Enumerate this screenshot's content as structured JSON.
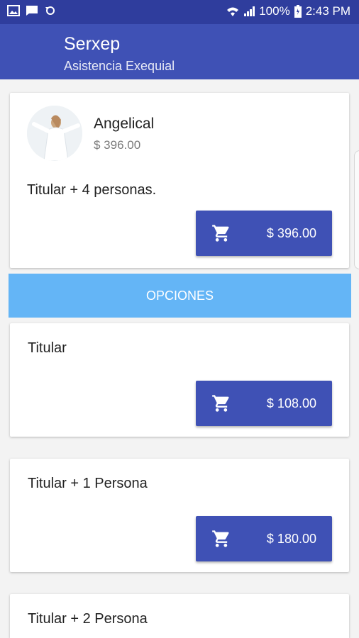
{
  "status_bar": {
    "battery": "100%",
    "time": "2:43 PM",
    "icons": [
      "image-icon",
      "message-icon",
      "sync-icon",
      "wifi-icon",
      "signal-icon",
      "battery-icon"
    ]
  },
  "app_bar": {
    "title": "Serxep",
    "subtitle": "Asistencia Exequial"
  },
  "plan": {
    "name": "Angelical",
    "price": "$ 396.00",
    "description": "Titular + 4 personas.",
    "button_label": "$ 396.00"
  },
  "options_header": "OPCIONES",
  "options": [
    {
      "title": "Titular",
      "button_label": "$ 108.00"
    },
    {
      "title": "Titular + 1 Persona",
      "button_label": "$ 180.00"
    },
    {
      "title": "Titular + 2 Persona"
    }
  ],
  "colors": {
    "primary": "#3f51b5",
    "primary_dark": "#2f3d9d",
    "accent_header": "#64b5f6"
  }
}
